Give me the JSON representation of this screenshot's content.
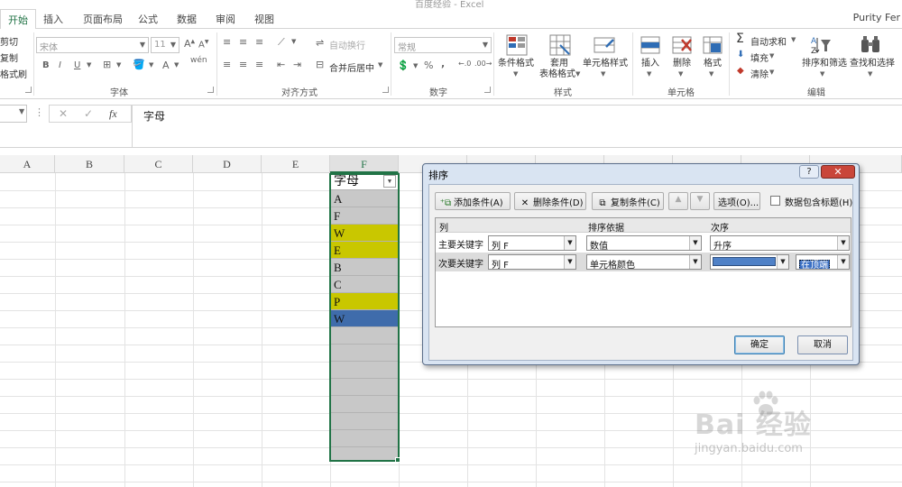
{
  "window": {
    "title": "百度经验 - Excel",
    "user": "Purity Fer"
  },
  "tabs": [
    "开始",
    "插入",
    "页面布局",
    "公式",
    "数据",
    "审阅",
    "视图"
  ],
  "active_tab": "开始",
  "clipboard": {
    "cut": "剪切",
    "copy": "复制",
    "format_painter": "格式刷"
  },
  "font": {
    "name": "宋体",
    "size": "11",
    "group_label": "字体",
    "bold": "B",
    "italic": "I",
    "underline": "U",
    "phonetic": "wén",
    "font_color_icon": "A"
  },
  "alignment": {
    "wrap_text": "自动换行",
    "merge_center": "合并后居中",
    "group_label": "对齐方式"
  },
  "number": {
    "format": "常规",
    "percent": "%",
    "comma": ",",
    "group_label": "数字"
  },
  "styles": {
    "conditional_format": "条件格式",
    "table_format_1": "套用",
    "table_format_2": "表格格式",
    "cell_styles": "单元格样式",
    "group_label": "样式"
  },
  "cells_group": {
    "insert": "插入",
    "delete": "删除",
    "format": "格式",
    "group_label": "单元格"
  },
  "editing": {
    "autosum": "自动求和",
    "fill": "填充",
    "clear": "清除",
    "sort_filter": "排序和筛选",
    "find_select": "查找和选择",
    "group_label": "编辑"
  },
  "formula_bar": {
    "fx": "fx",
    "content": "字母"
  },
  "columns": [
    "A",
    "B",
    "C",
    "D",
    "E",
    "F"
  ],
  "selected_column": "F",
  "column_f": {
    "header": "字母",
    "cells": [
      {
        "value": "A",
        "fill": "#c8c8c8"
      },
      {
        "value": "F",
        "fill": "#c8c8c8"
      },
      {
        "value": "W",
        "fill": "#c9c700"
      },
      {
        "value": "E",
        "fill": "#c9c700"
      },
      {
        "value": "B",
        "fill": "#c8c8c8"
      },
      {
        "value": "C",
        "fill": "#c8c8c8"
      },
      {
        "value": "P",
        "fill": "#c9c700"
      },
      {
        "value": "W",
        "fill": "#3f6cab"
      }
    ]
  },
  "sort_dialog": {
    "title": "排序",
    "help": "?",
    "close": "✕",
    "add_condition": "添加条件(A)",
    "delete_condition": "删除条件(D)",
    "copy_condition": "复制条件(C)",
    "options": "选项(O)...",
    "has_header": "数据包含标题(H)",
    "has_header_checked": false,
    "columns_header": {
      "column": "列",
      "sort_on": "排序依据",
      "order": "次序"
    },
    "rows": [
      {
        "label": "主要关键字",
        "column": "列 F",
        "sort_on": "数值",
        "order": "升序"
      },
      {
        "label": "次要关键字",
        "column": "列 F",
        "sort_on": "单元格颜色",
        "order_color": "#4f81c7",
        "position": "在顶端"
      }
    ],
    "ok": "确定",
    "cancel": "取消"
  },
  "watermark": {
    "main": "Bai 经验",
    "sub": "jingyan.baidu.com"
  }
}
